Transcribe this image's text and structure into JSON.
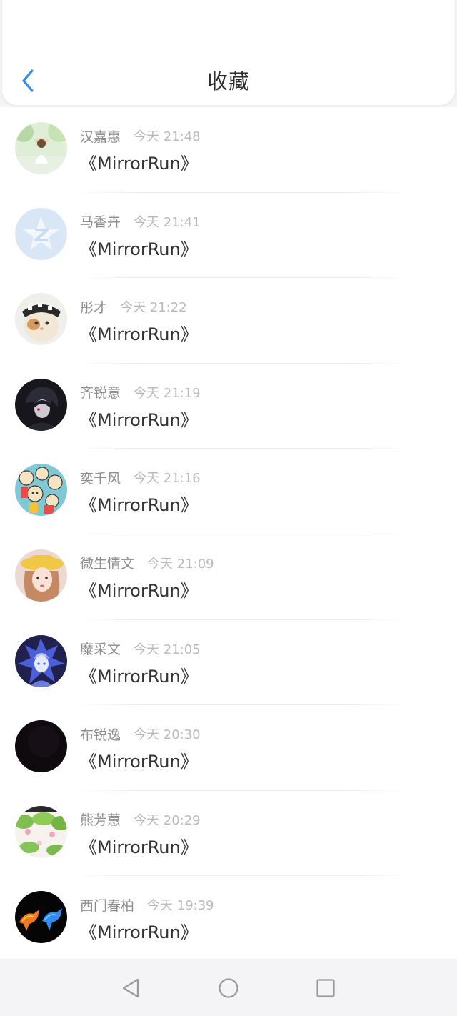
{
  "header": {
    "title": "收藏",
    "back_icon": "chevron-left-icon",
    "accent_color": "#2d8cf0"
  },
  "favorites": [
    {
      "name": "汉嘉惠",
      "time": "今天 21:48",
      "title": "《MirrorRun》",
      "avatar": "girl-garden"
    },
    {
      "name": "马香卉",
      "time": "今天 21:41",
      "title": "《MirrorRun》",
      "avatar": "qq-default"
    },
    {
      "name": "彤才",
      "time": "今天 21:22",
      "title": "《MirrorRun》",
      "avatar": "cat-hat"
    },
    {
      "name": "齐锐意",
      "time": "今天 21:19",
      "title": "《MirrorRun》",
      "avatar": "anime-dark"
    },
    {
      "name": "奕千风",
      "time": "今天 21:16",
      "title": "《MirrorRun》",
      "avatar": "cartoon-faces"
    },
    {
      "name": "微生情文",
      "time": "今天 21:09",
      "title": "《MirrorRun》",
      "avatar": "girl-hat"
    },
    {
      "name": "糜采文",
      "time": "今天 21:05",
      "title": "《MirrorRun》",
      "avatar": "anime-blue"
    },
    {
      "name": "布锐逸",
      "time": "今天 20:30",
      "title": "《MirrorRun》",
      "avatar": "black"
    },
    {
      "name": "熊芳蕙",
      "time": "今天 20:29",
      "title": "《MirrorRun》",
      "avatar": "flowers"
    },
    {
      "name": "西门春柏",
      "time": "今天 19:39",
      "title": "《MirrorRun》",
      "avatar": "fire-horses"
    }
  ],
  "navbar": {
    "back_icon": "triangle-back-icon",
    "home_icon": "circle-home-icon",
    "recent_icon": "square-recent-icon"
  }
}
